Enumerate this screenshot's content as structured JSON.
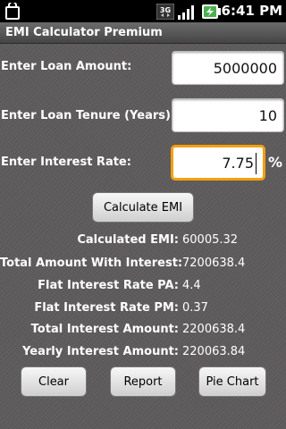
{
  "status_bar": {
    "network_type": "3G",
    "time": "6:41 PM",
    "icons": [
      "notification-icon",
      "network-3g-icon",
      "signal-strength-icon",
      "battery-charging-icon"
    ]
  },
  "app": {
    "title": "EMI Calculator Premium"
  },
  "form": {
    "loan_amount": {
      "label": "Enter Loan Amount:",
      "value": "5000000"
    },
    "loan_tenure": {
      "label": "Enter Loan Tenure (Years):",
      "value": "10"
    },
    "interest_rate": {
      "label": "Enter Interest Rate:",
      "value": "7.75",
      "unit": "%"
    },
    "calculate_label": "Calculate EMI"
  },
  "results": [
    {
      "label": "Calculated EMI:",
      "value": "60005.32"
    },
    {
      "label": "Total Amount With Interest:",
      "value": "7200638.4"
    },
    {
      "label": "Flat Interest Rate PA:",
      "value": "4.4"
    },
    {
      "label": "Flat Interest Rate PM:",
      "value": "0.37"
    },
    {
      "label": "Total Interest Amount:",
      "value": "2200638.4"
    },
    {
      "label": "Yearly Interest Amount:",
      "value": "220063.84"
    }
  ],
  "actions": {
    "clear_label": "Clear",
    "report_label": "Report",
    "pie_chart_label": "Pie Chart"
  },
  "colors": {
    "focus_border": "#f59f0f",
    "background": "#5e5b5c",
    "battery_accent": "#4caf50"
  }
}
